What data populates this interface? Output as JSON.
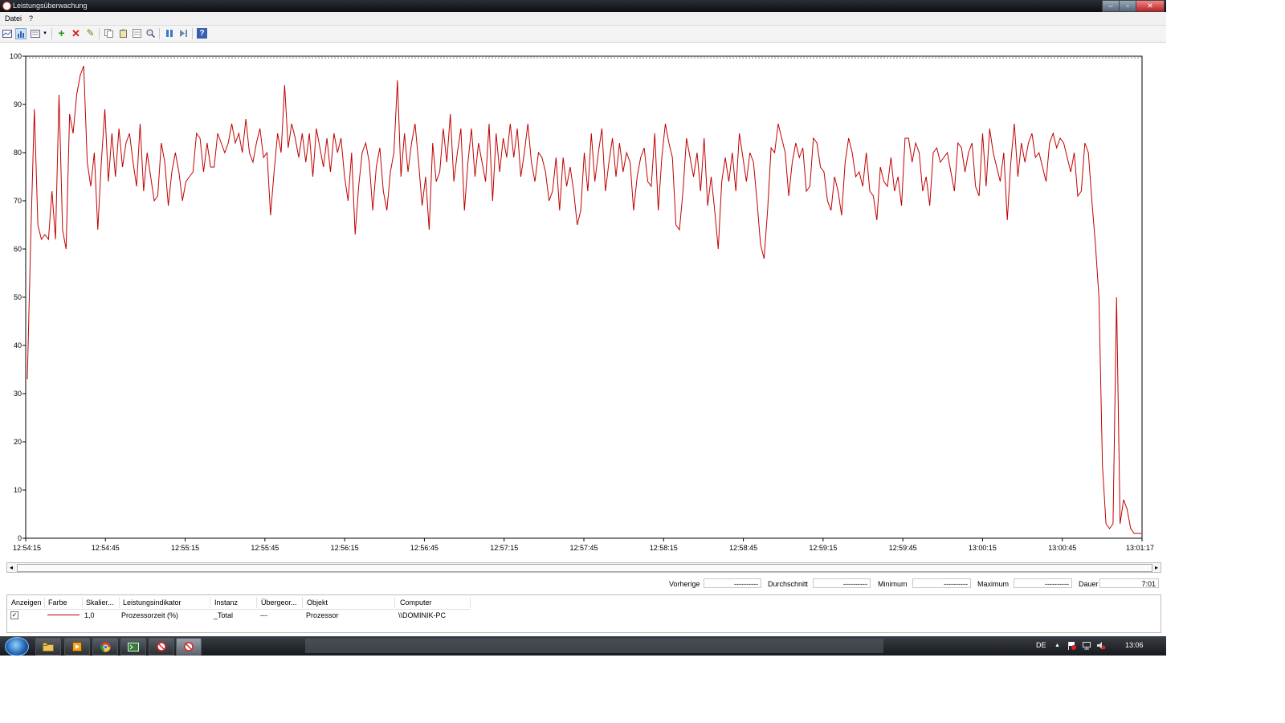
{
  "window": {
    "title": "Leistungsüberwachung"
  },
  "menu": {
    "items": [
      "Datei",
      "?"
    ]
  },
  "toolbar": {
    "icons": [
      "view-graph-icon",
      "view-histogram-icon",
      "view-report-icon",
      "add-counter-icon",
      "delete-counter-icon",
      "highlight-icon",
      "copy-properties-icon",
      "paste-counter-list-icon",
      "properties-icon",
      "zoom-icon",
      "freeze-display-icon",
      "update-data-icon",
      "help-icon"
    ]
  },
  "chart_data": {
    "type": "line",
    "ylim": [
      0,
      100
    ],
    "yticks": [
      0,
      10,
      20,
      30,
      40,
      50,
      60,
      70,
      80,
      90,
      100
    ],
    "xtick_labels": [
      "12:54:15",
      "12:54:45",
      "12:55:15",
      "12:55:45",
      "12:56:15",
      "12:56:45",
      "12:57:15",
      "12:57:45",
      "12:58:15",
      "12:58:45",
      "12:59:15",
      "12:59:45",
      "13:00:15",
      "13:00:45",
      "13:01:17"
    ],
    "grid": false,
    "series": [
      {
        "name": "Prozessorzeit (%)",
        "color": "#c00000",
        "values": [
          33,
          63,
          89,
          65,
          62,
          63,
          62,
          72,
          62,
          92,
          64,
          60,
          88,
          84,
          92,
          96,
          98,
          78,
          73,
          80,
          64,
          78,
          89,
          74,
          84,
          75,
          85,
          77,
          82,
          84,
          78,
          73,
          86,
          72,
          80,
          75,
          70,
          71,
          82,
          78,
          69,
          76,
          80,
          76,
          70,
          74,
          75,
          76,
          84,
          83,
          76,
          82,
          77,
          77,
          84,
          82,
          80,
          82,
          86,
          82,
          84,
          80,
          87,
          80,
          78,
          82,
          85,
          79,
          80,
          67,
          76,
          84,
          80,
          94,
          81,
          86,
          83,
          79,
          84,
          78,
          84,
          75,
          85,
          81,
          77,
          83,
          76,
          84,
          80,
          83,
          75,
          70,
          80,
          63,
          73,
          80,
          82,
          78,
          68,
          77,
          81,
          72,
          68,
          76,
          80,
          95,
          75,
          84,
          76,
          82,
          86,
          78,
          69,
          75,
          64,
          82,
          74,
          76,
          85,
          78,
          88,
          74,
          80,
          85,
          68,
          78,
          85,
          75,
          82,
          78,
          74,
          86,
          70,
          84,
          76,
          83,
          79,
          86,
          79,
          85,
          75,
          80,
          86,
          78,
          74,
          80,
          79,
          76,
          70,
          72,
          79,
          68,
          79,
          73,
          77,
          72,
          65,
          68,
          80,
          72,
          84,
          74,
          80,
          85,
          72,
          78,
          83,
          75,
          82,
          76,
          80,
          78,
          68,
          75,
          79,
          81,
          74,
          73,
          84,
          68,
          79,
          86,
          82,
          79,
          65,
          64,
          72,
          83,
          79,
          75,
          80,
          72,
          83,
          69,
          75,
          68,
          60,
          74,
          79,
          74,
          80,
          72,
          84,
          79,
          74,
          80,
          78,
          70,
          61,
          58,
          68,
          81,
          80,
          86,
          83,
          80,
          71,
          78,
          82,
          79,
          81,
          72,
          73,
          83,
          82,
          77,
          76,
          70,
          68,
          75,
          72,
          67,
          78,
          83,
          80,
          75,
          76,
          73,
          80,
          72,
          71,
          66,
          77,
          74,
          73,
          79,
          72,
          75,
          69,
          83,
          83,
          78,
          82,
          80,
          72,
          75,
          69,
          80,
          81,
          78,
          79,
          80,
          76,
          72,
          82,
          81,
          76,
          80,
          82,
          73,
          71,
          84,
          73,
          85,
          80,
          77,
          74,
          80,
          66,
          78,
          86,
          75,
          82,
          78,
          82,
          84,
          79,
          80,
          77,
          74,
          82,
          84,
          81,
          83,
          82,
          79,
          76,
          80,
          71,
          72,
          82,
          80,
          70,
          61,
          50,
          15,
          3,
          2,
          3,
          50,
          3,
          8,
          6,
          2,
          1,
          1,
          1
        ]
      }
    ]
  },
  "scrollbar": {
    "left_arrow": "◂",
    "right_arrow": "▸"
  },
  "stats": {
    "previous_label": "Vorherige",
    "previous_value": "----------",
    "average_label": "Durchschnitt",
    "average_value": "----------",
    "minimum_label": "Minimum",
    "minimum_value": "----------",
    "maximum_label": "Maximum",
    "maximum_value": "----------",
    "duration_label": "Dauer",
    "duration_value": "7:01"
  },
  "legend": {
    "headers": [
      "Anzeigen",
      "Farbe",
      "Skalier...",
      "Leistungsindikator",
      "Instanz",
      "Übergeor...",
      "Objekt",
      "Computer"
    ],
    "row": {
      "checked": "✓",
      "scale": "1,0",
      "counter": "Prozessorzeit (%)",
      "instance": "_Total",
      "parent": "---",
      "object": "Prozessor",
      "computer": "\\\\DOMINIK-PC"
    }
  },
  "taskbar": {
    "buttons": [
      "folder-icon",
      "media-player-icon",
      "chrome-icon",
      "terminal-icon",
      "perfmon-icon",
      "perfmon-active-icon"
    ],
    "language": "DE",
    "tray_arrow": "▲",
    "clock": "13:06"
  }
}
